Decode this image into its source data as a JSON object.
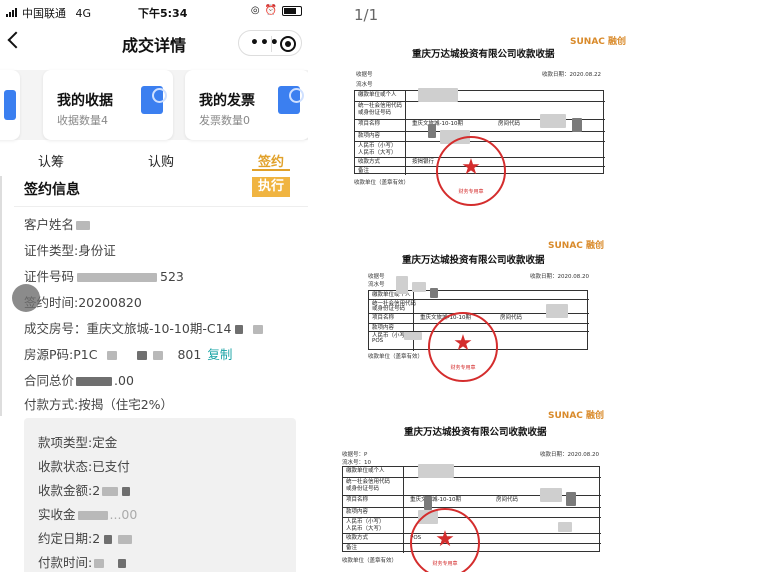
{
  "status_bar": {
    "carrier": "中国联通",
    "network": "4G",
    "time": "下午5:34"
  },
  "nav": {
    "title": "成交详情"
  },
  "cards": [
    {
      "title": "我的收据",
      "sub": "收据数量4"
    },
    {
      "title": "我的发票",
      "sub": "发票数量0"
    }
  ],
  "tabs": [
    {
      "label": "认筹",
      "active": false
    },
    {
      "label": "认购",
      "active": false
    },
    {
      "label": "签约",
      "active": true
    }
  ],
  "sign_info": {
    "title": "签约信息",
    "status": "执行",
    "rows": {
      "customer_name": "客户姓名",
      "id_type": "证件类型:身份证",
      "id_number_prefix": "证件号码",
      "id_number_suffix": "523",
      "sign_time": "签约时间:20200820",
      "room": "成交房号：重庆文旅城-10-10期-C14",
      "source_prefix": "房源P码:P1C",
      "source_suffix": "801",
      "copy_label": "复制",
      "contract_prefix": "合同总价",
      "contract_suffix": ".00",
      "payment": "付款方式:按揭（住宅2%）"
    }
  },
  "payment_box": {
    "type": "款项类型:定金",
    "status": "收款状态:已支付",
    "amount": "收款金额:2",
    "actual": "实收金",
    "actual_suffix": "...00",
    "due_date": "约定日期:2",
    "pay_time": "付款时间:"
  },
  "doc_viewer": {
    "page_counter": "1/1",
    "logo": "SUNAC 融创",
    "receipts": [
      {
        "title": "重庆万达城投资有限公司收款收据",
        "receipt_no": "收据号",
        "serial_no": "流水号",
        "date": "收款日期：2020.08.22",
        "payer": "缴款单位或个人",
        "credit_code": "统一社会信用代码",
        "id_number": "或身份证号码",
        "project_label": "项目名称",
        "project_value": "重庆文旅城-10-10期",
        "room_label": "房间代码",
        "content_label": "款项内容",
        "rmb_lower": "人民币（小写）",
        "rmb_upper": "人民币（大写）",
        "method_label": "收款方式",
        "method_value": "按揭银行",
        "remark_label": "备注",
        "footer": "收款单位（盖章有效）"
      },
      {
        "title": "重庆万达城投资有限公司收款收据",
        "receipt_no": "收据号",
        "serial_no": "流水号",
        "date": "收款日期：2020.08.20",
        "payer": "缴款单位或个人",
        "credit_code": "统一社会信用代码",
        "id_number": "或身份证号码",
        "project_label": "项目名称",
        "project_value": "重庆文旅城-10-10期",
        "room_label": "房间代码",
        "content_label": "款项内容",
        "rmb_lower": "人民币（小写）",
        "rmb_upper": "人民币（大写）",
        "method_label": "收款方式",
        "method_value": "POS",
        "remark_label": "备注",
        "footer": "收款单位（盖章有效）"
      },
      {
        "title": "重庆万达城投资有限公司收款收据",
        "receipt_no": "收据号：P",
        "serial_no": "流水号：10",
        "date": "收款日期：2020.08.20",
        "payer": "缴款单位或个人",
        "credit_code": "统一社会信用代码",
        "id_number": "或身份证号码",
        "project_label": "项目名称",
        "project_value": "重庆文旅城-10-10期",
        "room_label": "房间代码",
        "content_label": "款项内容",
        "rmb_lower": "人民币（小写）",
        "rmb_upper": "人民币（大写）",
        "method_label": "收款方式",
        "method_value": "POS",
        "remark_label": "备注",
        "footer": "收款单位（盖章有效）"
      }
    ],
    "seal_text": "财务专用章"
  },
  "colors": {
    "accent": "#e1a12a",
    "badge": "#f0b441",
    "brand_blue": "#3b7ff0",
    "copy_link": "#1aa4a6",
    "seal_red": "#d42d2d"
  }
}
